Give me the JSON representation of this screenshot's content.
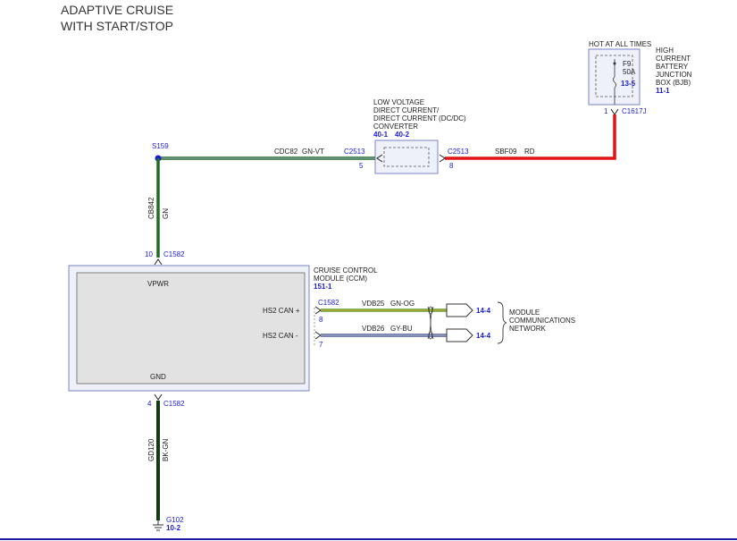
{
  "title": {
    "line1": "ADAPTIVE CRUISE",
    "line2": "WITH START/STOP"
  },
  "colors": {
    "wire_green": "#1f6e1f",
    "wire_red": "#e01515",
    "wire_darkgreen": "#0f3d10",
    "wire_gnog": "#5aa02c",
    "wire_gybu": "#4a5a9a",
    "component_border": "#7b84c8",
    "pin_blue": "#1a1adc",
    "bottom_rule": "#1a1a9a"
  },
  "bjb": {
    "hot_label": "HOT AT ALL TIMES",
    "name": [
      "HIGH",
      "CURRENT",
      "BATTERY",
      "JUNCTION",
      "BOX (BJB)"
    ],
    "ref": "11-1",
    "fuse": "F9",
    "amps": "50A",
    "fuse_ref": "13-5",
    "pin": "1",
    "connector": "C1617J"
  },
  "dcdc": {
    "name": [
      "LOW VOLTAGE",
      "DIRECT CURRENT/",
      "DIRECT CURRENT (DC/DC)",
      "CONVERTER"
    ],
    "ref1": "40-1",
    "ref2": "40-2",
    "left_connector": "C2513",
    "left_pin": "5",
    "right_connector": "C2513",
    "right_pin": "8"
  },
  "wires": {
    "sbf09": {
      "circuit": "SBF09",
      "color": "RD"
    },
    "cdc82": {
      "circuit": "CDC82",
      "color": "GN-VT"
    },
    "cb842": {
      "circuit": "CB842",
      "color": "GN"
    },
    "vdb25": {
      "circuit": "VDB25",
      "color": "GN-OG"
    },
    "vdb26": {
      "circuit": "VDB26",
      "color": "GY-BU"
    },
    "gd120": {
      "circuit": "GD120",
      "color": "BK-GN"
    }
  },
  "splice": {
    "label": "S159"
  },
  "ccm": {
    "name": [
      "CRUISE CONTROL",
      "MODULE (CCM)"
    ],
    "ref": "151-1",
    "vpwr": "VPWR",
    "gnd": "GND",
    "hs2_plus": "HS2 CAN +",
    "hs2_minus": "HS2 CAN -",
    "top_pin": "10",
    "top_connector": "C1582",
    "can_connector": "C1582",
    "can_plus_pin": "8",
    "can_minus_pin": "7",
    "bottom_pin": "4",
    "bottom_connector": "C1582"
  },
  "network": {
    "name": [
      "MODULE",
      "COMMUNICATIONS",
      "NETWORK"
    ],
    "ref_plus": "14-4",
    "ref_minus": "14-4"
  },
  "ground": {
    "label": "G102",
    "ref": "10-2"
  }
}
